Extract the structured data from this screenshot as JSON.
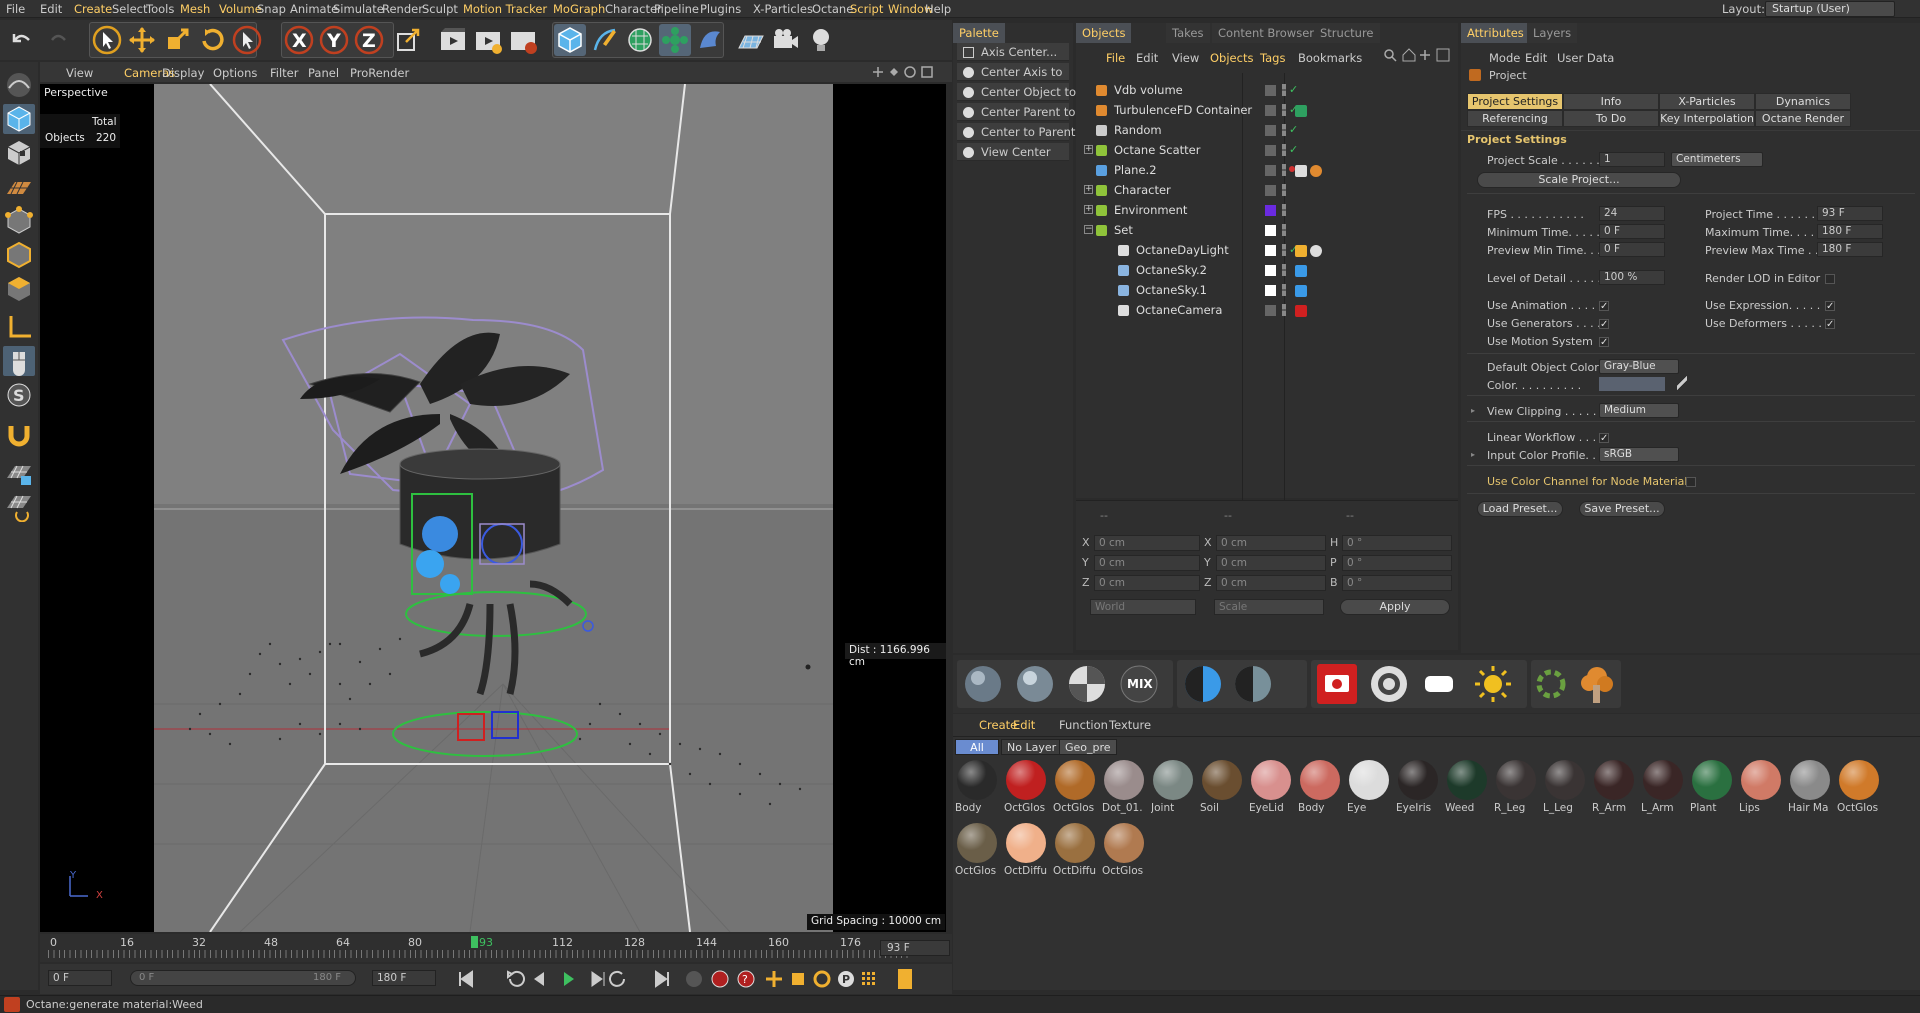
{
  "menubar": {
    "items": [
      "File",
      "Edit",
      "Create",
      "Select",
      "Tools",
      "Mesh",
      "Volume",
      "Snap",
      "Animate",
      "Simulate",
      "Render",
      "Sculpt",
      "Motion Tracker",
      "MoGraph",
      "Character",
      "Pipeline",
      "Plugins",
      "X-Particles",
      "Octane",
      "Script",
      "Window",
      "Help"
    ],
    "layout_label": "Layout:",
    "layout_value": "Startup (User)"
  },
  "viewport": {
    "menus": [
      "View",
      "Cameras",
      "Display",
      "Options",
      "Filter",
      "Panel",
      "ProRender"
    ],
    "name": "Perspective",
    "stats_header": "Total",
    "stats_label": "Objects",
    "stats_value": "220",
    "distance": "Dist : 1166.996 cm",
    "grid_spacing": "Grid Spacing : 10000 cm",
    "axis_y": "Y",
    "axis_x": "X"
  },
  "timeline": {
    "ticks": [
      "0",
      "16",
      "32",
      "48",
      "64",
      "80",
      "93",
      "112",
      "128",
      "144",
      "160",
      "176"
    ],
    "current_frame": "93 F",
    "start_field": "0 F",
    "range_start": "0 F",
    "range_end": "180 F",
    "end_field": "180 F"
  },
  "status": "Octane:generate material:Weed",
  "palette": {
    "tab": "Palette",
    "items": [
      "Axis Center...",
      "Center Axis to",
      "Center Object to",
      "Center Parent to",
      "Center to Parent",
      "View Center"
    ]
  },
  "objects": {
    "tabs": [
      "Objects",
      "Takes",
      "Content Browser",
      "Structure"
    ],
    "menu": [
      "File",
      "Edit",
      "View",
      "Objects",
      "Tags",
      "Bookmarks"
    ],
    "rows": [
      {
        "name": "Vdb volume",
        "indent": 0,
        "expand": "",
        "color": "#e08a30"
      },
      {
        "name": "TurbulenceFD Container",
        "indent": 0,
        "expand": "",
        "color": "#e08a30"
      },
      {
        "name": "Random",
        "indent": 0,
        "expand": "",
        "color": "#cccccc"
      },
      {
        "name": "Octane Scatter",
        "indent": 0,
        "expand": "+",
        "color": "#8fc33a"
      },
      {
        "name": "Plane.2",
        "indent": 0,
        "expand": "",
        "color": "#5aa0e0"
      },
      {
        "name": "Character",
        "indent": 0,
        "expand": "+",
        "color": "#8fc33a"
      },
      {
        "name": "Environment",
        "indent": 0,
        "expand": "+",
        "color": "#8fc33a"
      },
      {
        "name": "Set",
        "indent": 0,
        "expand": "-",
        "color": "#8fc33a"
      },
      {
        "name": "OctaneDayLight",
        "indent": 1,
        "expand": "",
        "color": "#dddddd"
      },
      {
        "name": "OctaneSky.2",
        "indent": 1,
        "expand": "",
        "color": "#8ab4e0"
      },
      {
        "name": "OctaneSky.1",
        "indent": 1,
        "expand": "",
        "color": "#8ab4e0"
      },
      {
        "name": "OctaneCamera",
        "indent": 1,
        "expand": "",
        "color": "#dddddd"
      }
    ]
  },
  "coordinates": {
    "headers": [
      "--",
      "--",
      "--"
    ],
    "rows": [
      {
        "a": "X",
        "av": "0 cm",
        "b": "X",
        "bv": "0 cm",
        "c": "H",
        "cv": "0 °"
      },
      {
        "a": "Y",
        "av": "0 cm",
        "b": "Y",
        "bv": "0 cm",
        "c": "P",
        "cv": "0 °"
      },
      {
        "a": "Z",
        "av": "0 cm",
        "b": "Z",
        "bv": "0 cm",
        "c": "B",
        "cv": "0 °"
      }
    ],
    "mode": "World",
    "scale": "Scale",
    "apply": "Apply"
  },
  "attributes": {
    "tabs": [
      "Attributes",
      "Layers"
    ],
    "menu": [
      "Mode",
      "Edit",
      "User Data"
    ],
    "title": "Project",
    "subtabs_row1": [
      "Project Settings",
      "Info",
      "X-Particles",
      "Dynamics"
    ],
    "subtabs_row2": [
      "Referencing",
      "To Do",
      "Key Interpolation",
      "Octane Render"
    ],
    "section": "Project Settings",
    "project_scale_label": "Project Scale . . . . . .",
    "project_scale_value": "1",
    "project_scale_unit": "Centimeters",
    "scale_button": "Scale Project...",
    "fps_label": "FPS . . . . . . . . . . .",
    "fps_value": "24",
    "project_time_label": "Project Time . . . . . .",
    "project_time_value": "93 F",
    "min_time_label": "Minimum Time. . . . . .",
    "min_time_value": "0 F",
    "max_time_label": "Maximum Time. . . . . .",
    "max_time_value": "180 F",
    "prev_min_label": "Preview Min Time. . . .",
    "prev_min_value": "0 F",
    "prev_max_label": "Preview Max Time . . .",
    "prev_max_value": "180 F",
    "lod_label": "Level of Detail . . . . .",
    "lod_value": "100 %",
    "render_lod_label": "Render LOD in Editor",
    "use_anim_label": "Use Animation . . . . .",
    "use_expr_label": "Use Expression. . . . .",
    "use_gen_label": "Use Generators . . . .",
    "use_def_label": "Use Deformers . . . . .",
    "use_motion_label": "Use Motion System",
    "def_color_label": "Default Object Color",
    "def_color_value": "Gray-Blue",
    "color_label": "Color. . . . . . . . . .",
    "view_clip_label": "View Clipping . . . . .",
    "view_clip_value": "Medium",
    "linear_label": "Linear Workflow . . .",
    "input_profile_label": "Input Color Profile. .",
    "input_profile_value": "sRGB",
    "use_color_channel_label": "Use Color Channel for Node Material",
    "load_preset": "Load Preset...",
    "save_preset": "Save Preset...",
    "check": "✓"
  },
  "materials": {
    "menu": [
      "Create",
      "Edit",
      "Function",
      "Texture"
    ],
    "filters": [
      "All",
      "No Layer",
      "Geo_pre"
    ],
    "items": [
      {
        "name": "Body",
        "color": "#2a2a2a"
      },
      {
        "name": "OctGlos",
        "color": "#c02020"
      },
      {
        "name": "OctGlos",
        "color": "#b06a28"
      },
      {
        "name": "Dot_01.",
        "color": "#9a8c8c"
      },
      {
        "name": "Joint",
        "color": "#7b8884"
      },
      {
        "name": "Soil",
        "color": "#6a4e30"
      },
      {
        "name": "EyeLid",
        "color": "#d8908e"
      },
      {
        "name": "Body",
        "color": "#cc6a60"
      },
      {
        "name": "Eye",
        "color": "#dcdcdc"
      },
      {
        "name": "EyeIris",
        "color": "#2b2626"
      },
      {
        "name": "Weed",
        "color": "#1d3a2a"
      },
      {
        "name": "R_Leg",
        "color": "#3a3434"
      },
      {
        "name": "L_Leg",
        "color": "#3a3434"
      },
      {
        "name": "R_Arm",
        "color": "#3a2626"
      },
      {
        "name": "L_Arm",
        "color": "#3a2626"
      },
      {
        "name": "Plant",
        "color": "#2a7040"
      },
      {
        "name": "Lips",
        "color": "#d07a66"
      },
      {
        "name": "Hair Ma",
        "color": "#8a8a8a"
      },
      {
        "name": "OctGlos",
        "color": "#d07a2a"
      },
      {
        "name": "OctGlos",
        "color": "#6a5e48"
      },
      {
        "name": "OctDiffu",
        "color": "#f0b08a"
      },
      {
        "name": "OctDiffu",
        "color": "#9a7040"
      },
      {
        "name": "OctGlos",
        "color": "#b07a50"
      }
    ],
    "toolbar_mix": "MIX"
  }
}
